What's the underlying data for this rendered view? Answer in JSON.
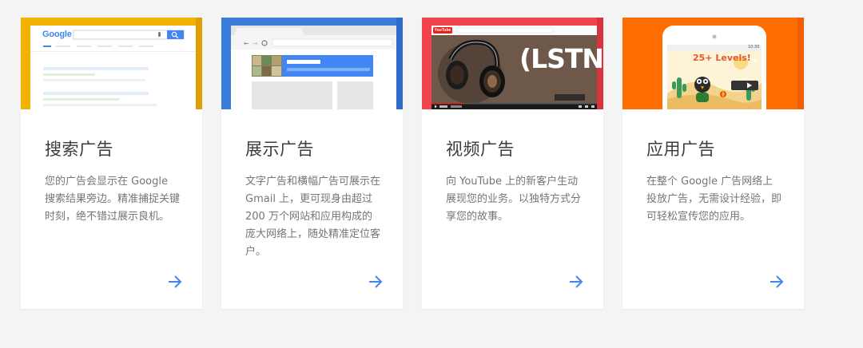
{
  "colors": {
    "search": "#f2b202",
    "display": "#3b7ddd",
    "video": "#f0434d",
    "app": "#ff6d00",
    "arrow": "#4285f4",
    "title": "#3c3c3c",
    "desc": "#757575"
  },
  "cards": [
    {
      "title": "搜索广告",
      "description": "您的广告会显示在 Google 搜索结果旁边。精准捕捉关键时刻，绝不错过展示良机。",
      "hero": {
        "logo_text": "Google"
      }
    },
    {
      "title": "展示广告",
      "description": "文字广告和横幅广告可展示在 Gmail 上，更可现身由超过 200 万个网站和应用构成的庞大网络上，随处精准定位客户。",
      "hero": {}
    },
    {
      "title": "视频广告",
      "description": "向 YouTube 上的新客户生动展现您的业务。以独特方式分享您的故事。",
      "hero": {
        "brand_text": "YouTube",
        "overlay_text": "(LSTN)"
      }
    },
    {
      "title": "应用广告",
      "description": "在整个 Google 广告网络上投放广告，无需设计经验，即可轻松宣传您的应用。",
      "hero": {
        "game_banner": "25+ Levels!",
        "status_time": "10:30"
      }
    }
  ]
}
